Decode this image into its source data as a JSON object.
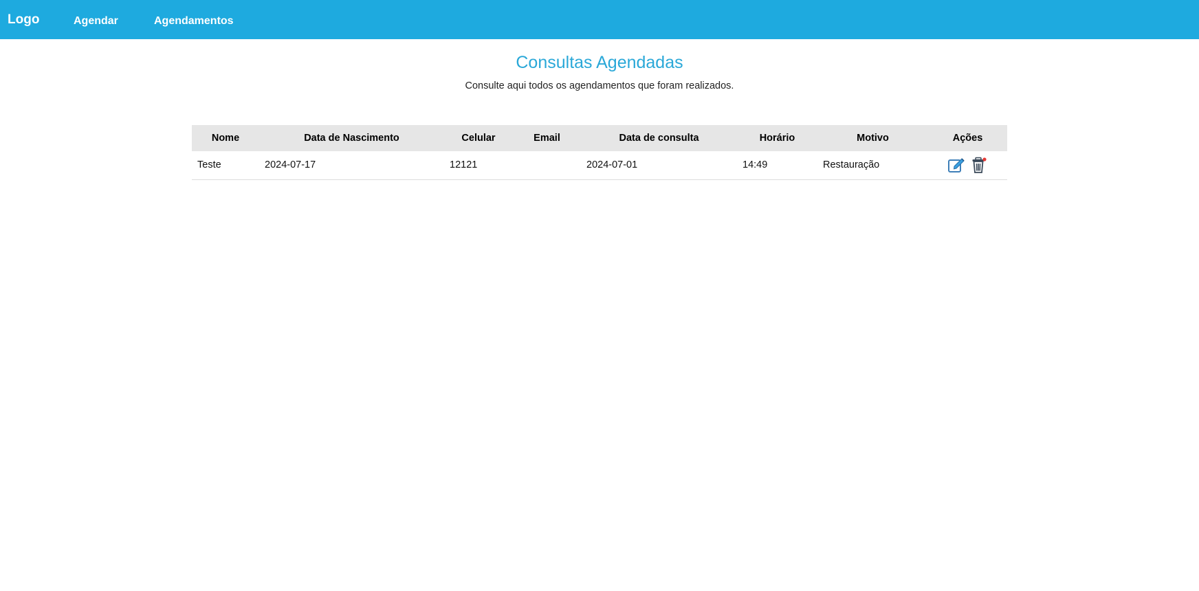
{
  "navbar": {
    "logo": "Logo",
    "links": [
      "Agendar",
      "Agendamentos"
    ]
  },
  "header": {
    "title": "Consultas Agendadas",
    "subtitle": "Consulte aqui todos os agendamentos que foram realizados."
  },
  "table": {
    "columns": [
      "Nome",
      "Data de Nascimento",
      "Celular",
      "Email",
      "Data de consulta",
      "Horário",
      "Motivo",
      "Ações"
    ],
    "rows": [
      {
        "nome": "Teste",
        "data_nascimento": "2024-07-17",
        "celular": "12121",
        "email": "",
        "data_consulta": "2024-07-01",
        "horario": "14:49",
        "motivo": "Restauração"
      }
    ]
  },
  "icons": {
    "edit": "edit-icon",
    "delete": "trash-icon"
  },
  "colors": {
    "navbar": "#1eaadf",
    "title": "#2aa8d8",
    "table_header": "#e6e6e6"
  }
}
